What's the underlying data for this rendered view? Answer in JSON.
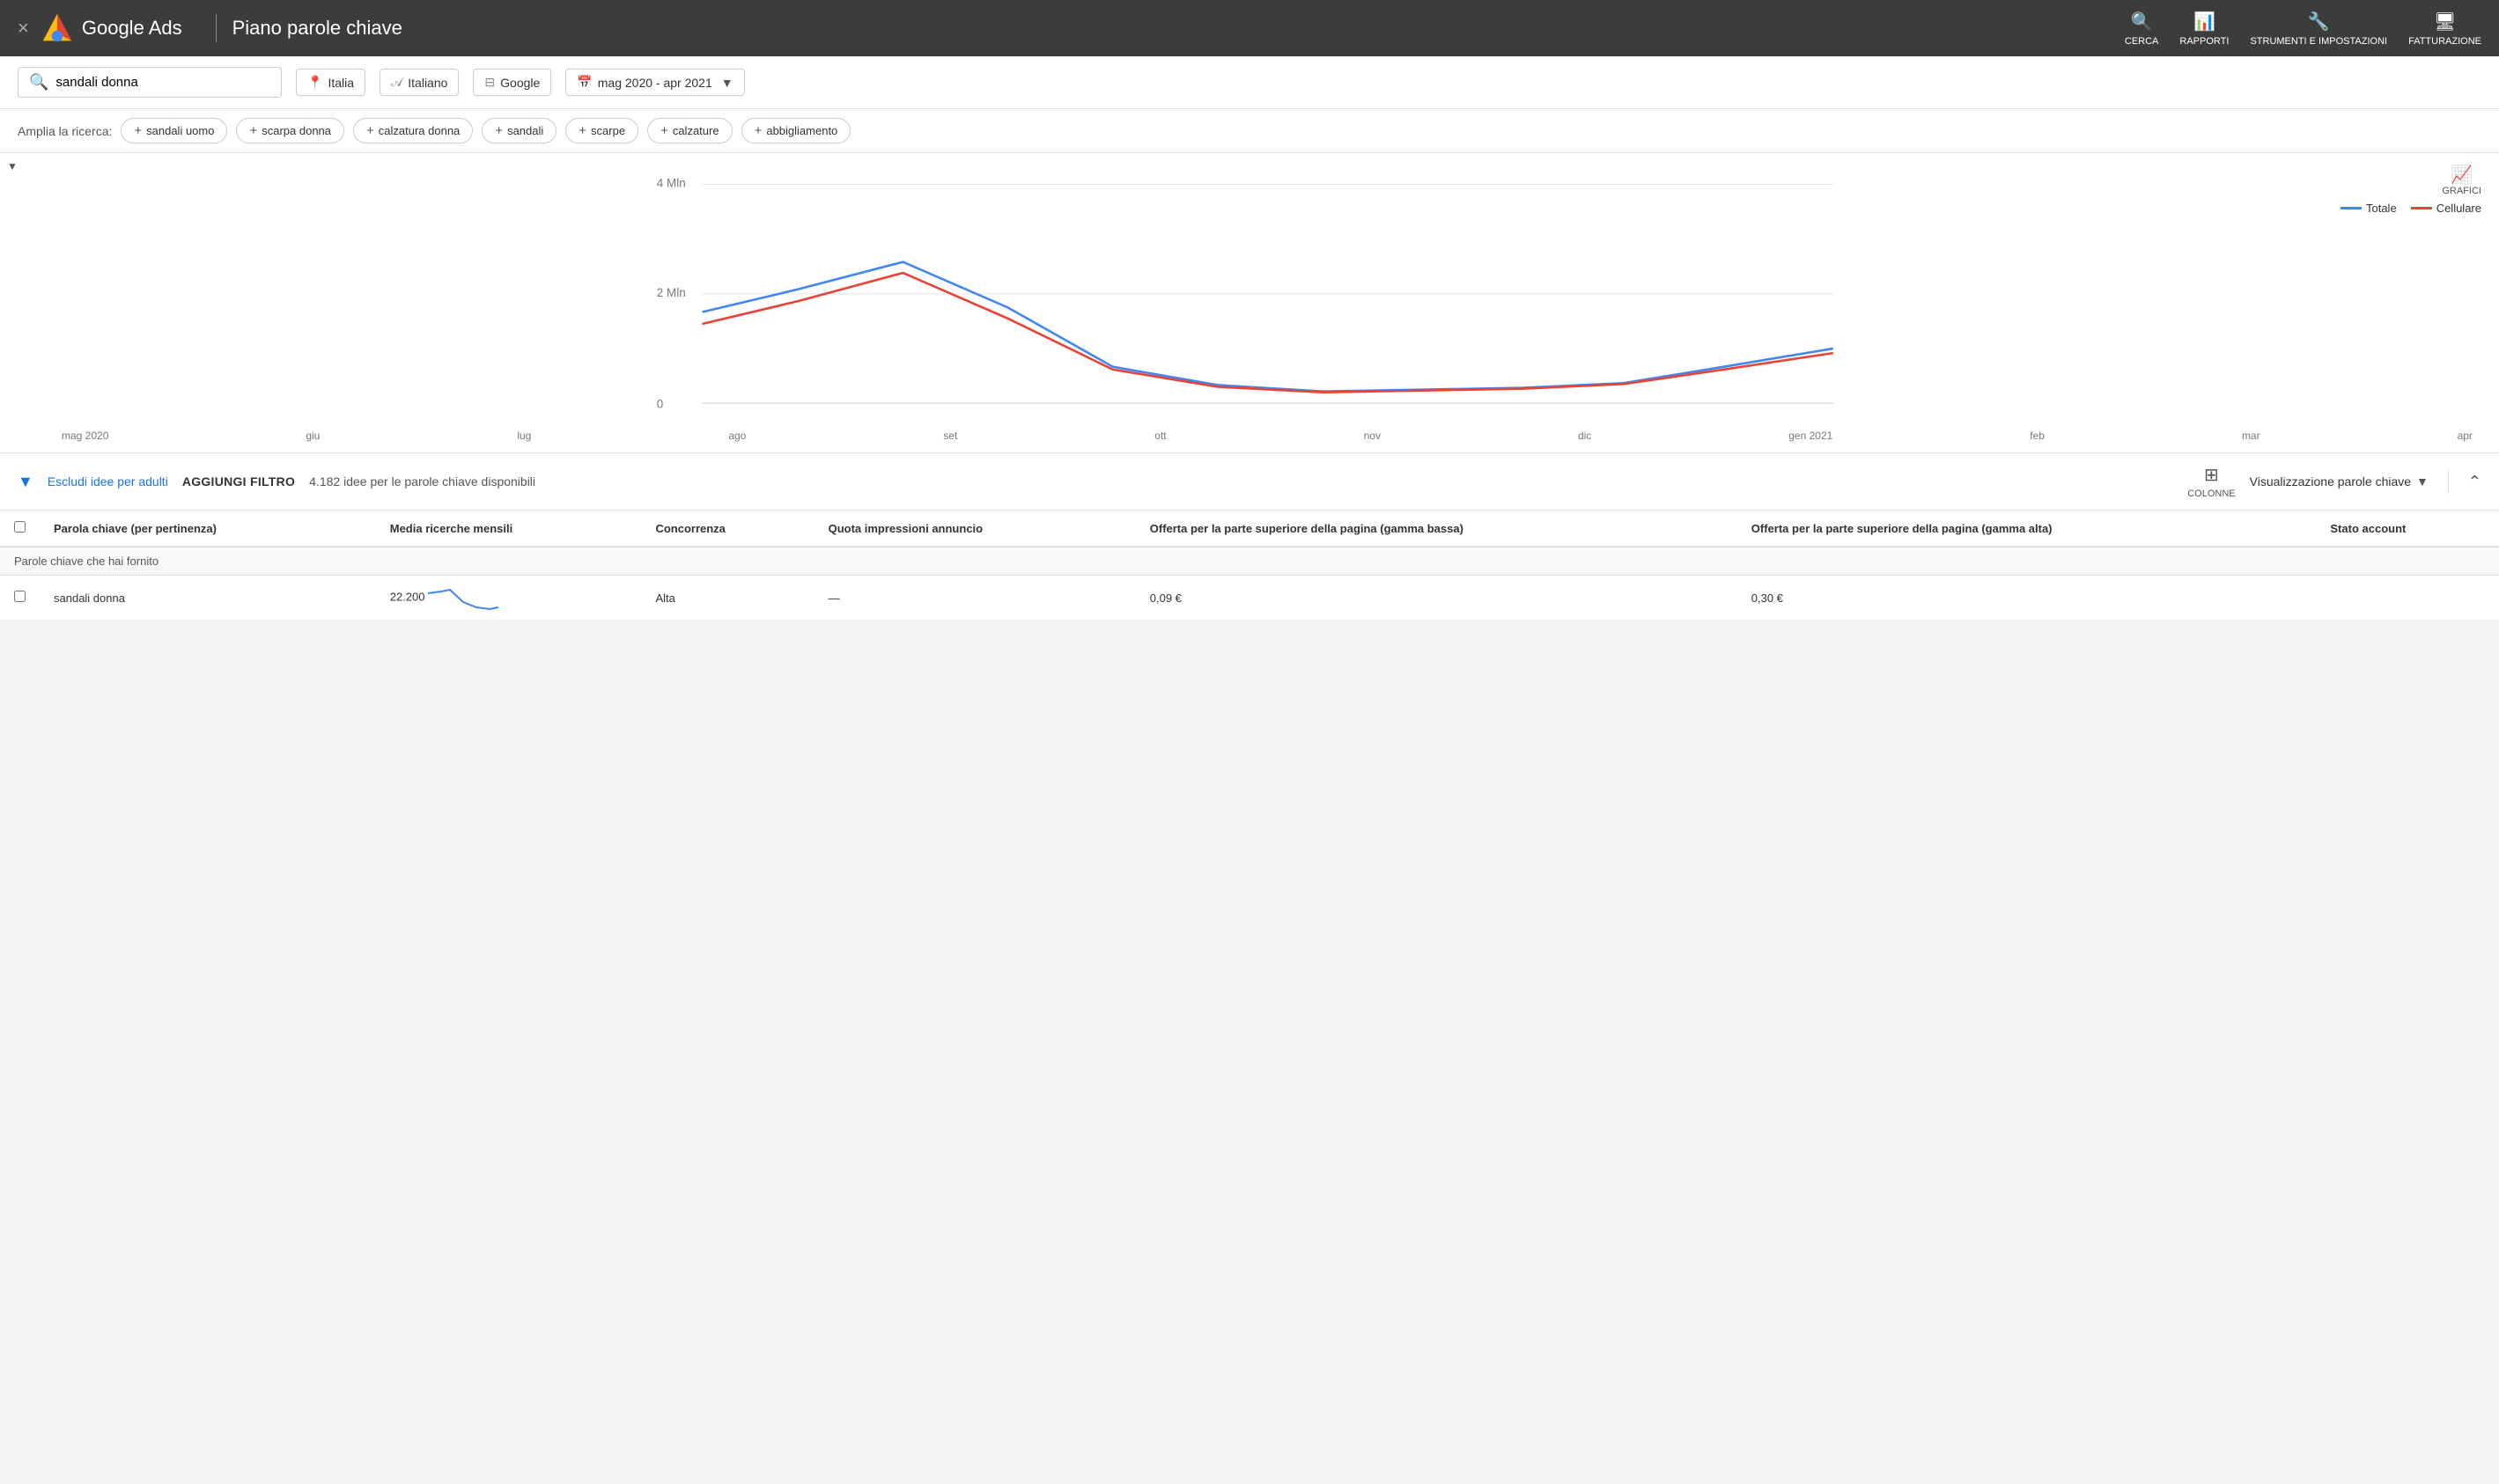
{
  "header": {
    "close_label": "×",
    "app_name": "Google Ads",
    "page_title": "Piano parole chiave",
    "actions": [
      {
        "id": "cerca",
        "label": "CERCA",
        "icon": "🔍"
      },
      {
        "id": "rapporti",
        "label": "RAPPORTI",
        "icon": "📊"
      },
      {
        "id": "strumenti",
        "label": "STRUMENTI E IMPOSTAZIONI",
        "icon": "🔧"
      },
      {
        "id": "fatturazione",
        "label": "FATTURAZIONE",
        "icon": "🖥"
      }
    ]
  },
  "search_bar": {
    "query": "sandali donna",
    "search_placeholder": "sandali donna",
    "location_label": "Italia",
    "language_label": "Italiano",
    "network_label": "Google",
    "date_range_label": "mag 2020 - apr 2021"
  },
  "related_terms": {
    "label": "Amplia la ricerca:",
    "chips": [
      "sandali uomo",
      "scarpa donna",
      "calzatura donna",
      "sandali",
      "scarpe",
      "calzature",
      "abbigliamento"
    ]
  },
  "chart": {
    "grafici_label": "GRAFICI",
    "legend": {
      "totale_label": "Totale",
      "cellulare_label": "Cellulare"
    },
    "y_labels": [
      "4 Mln",
      "2 Mln",
      "0"
    ],
    "x_labels": [
      "mag 2020",
      "giu",
      "lug",
      "ago",
      "set",
      "ott",
      "nov",
      "dic",
      "gen 2021",
      "feb",
      "mar",
      "apr"
    ]
  },
  "table_controls": {
    "exclude_adults_label": "Escludi idee per adulti",
    "add_filter_label": "AGGIUNGI FILTRO",
    "ideas_count": "4.182 idee per le parole chiave disponibili",
    "columns_label": "COLONNE",
    "view_label": "Visualizzazione parole chiave"
  },
  "table": {
    "headers": [
      "Parola chiave (per pertinenza)",
      "Media ricerche mensili",
      "Concorrenza",
      "Quota impressioni annuncio",
      "Offerta per la parte superiore della pagina (gamma bassa)",
      "Offerta per la parte superiore della pagina (gamma alta)",
      "Stato account"
    ],
    "section_label": "Parole chiave che hai fornito",
    "rows": [
      {
        "keyword": "sandali donna",
        "monthly_searches": "22.200",
        "competition": "Alta",
        "impression_share": "—",
        "bid_low": "0,09 €",
        "bid_high": "0,30 €",
        "account_status": ""
      }
    ]
  }
}
